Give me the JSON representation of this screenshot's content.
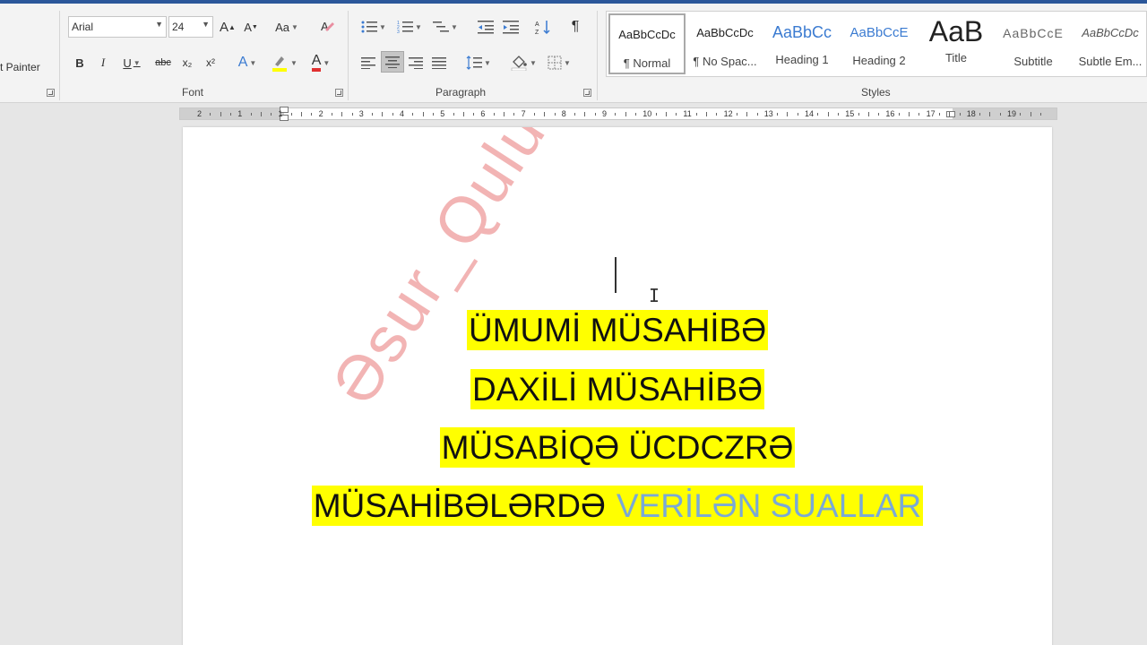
{
  "ribbon": {
    "format_painter_label": "t Painter",
    "font": {
      "group_label": "Font",
      "font_name": "Arial",
      "font_size": "24",
      "grow_label": "A",
      "shrink_label": "A",
      "case_label": "Aa",
      "bold_label": "B",
      "italic_label": "I",
      "underline_label": "U",
      "strike_label": "abc",
      "sub_label": "x₂",
      "sup_label": "x²",
      "effects_label": "A",
      "color_label": "A",
      "highlight_color": "#ffff00",
      "font_color": "#e03030"
    },
    "paragraph": {
      "group_label": "Paragraph"
    },
    "styles": {
      "group_label": "Styles",
      "items": [
        {
          "preview": "AaBbCcDc",
          "name": "¶ Normal"
        },
        {
          "preview": "AaBbCcDc",
          "name": "¶ No Spac..."
        },
        {
          "preview": "AaBbCc",
          "name": "Heading 1"
        },
        {
          "preview": "AaBbCcE",
          "name": "Heading 2"
        },
        {
          "preview": "AaB",
          "name": "Title"
        },
        {
          "preview": "AaBbCcE",
          "name": "Subtitle"
        },
        {
          "preview": "AaBbCcDc",
          "name": "Subtle Em..."
        }
      ]
    }
  },
  "ruler": {
    "numbers": [
      "2",
      "1",
      "1",
      "2",
      "3",
      "4",
      "5",
      "6",
      "7",
      "8",
      "9",
      "10",
      "11",
      "12",
      "13",
      "14",
      "15",
      "16",
      "17",
      "18",
      "19"
    ]
  },
  "document": {
    "watermark": "Əsur_Qulu vericilik",
    "lines": [
      {
        "text": "ÜMUMİ MÜSAHİBƏ"
      },
      {
        "text": "DAXİLİ MÜSAHİBƏ"
      },
      {
        "text": "MÜSABİQƏ ÜCDCZRƏ"
      },
      {
        "text": "MÜSAHİBƏLƏRDƏ",
        "text2": "VERİLƏN SUALLAR"
      }
    ],
    "highlight_color": "#ffff00",
    "text_color": "#111111",
    "accent_text_color": "#7aa9d6"
  }
}
